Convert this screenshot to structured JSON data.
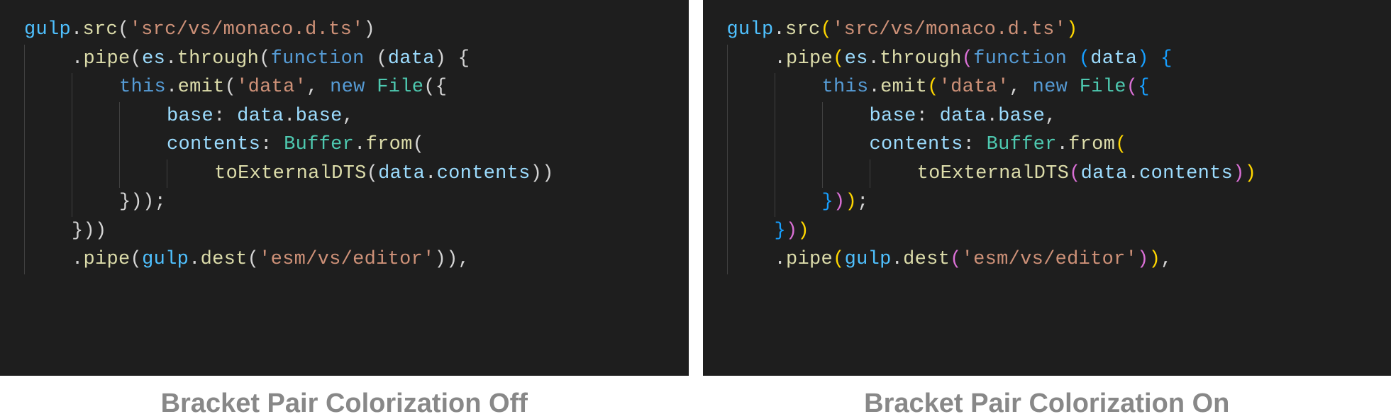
{
  "captions": {
    "left": "Bracket Pair Colorization Off",
    "right": "Bracket Pair Colorization On"
  },
  "palette": {
    "background": "#1e1e1e",
    "default_punc": "#d4d4d4",
    "bracket_levels": [
      "#ffd700",
      "#da70d6",
      "#179fff"
    ],
    "string": "#ce9178",
    "keyword": "#569cd6",
    "function": "#dcdcaa",
    "variable": "#9cdcfe",
    "object": "#4fc1ff",
    "type": "#4ec9b0"
  },
  "code": {
    "tokens": {
      "gulp": "gulp",
      "dot": ".",
      "src": "src",
      "open_paren": "(",
      "close_paren": ")",
      "open_brace": "{",
      "close_brace": "}",
      "str_monaco": "'src/vs/monaco.d.ts'",
      "pipe": "pipe",
      "es": "es",
      "through": "through",
      "function_kw": "function",
      "space": " ",
      "data": "data",
      "this_kw": "this",
      "emit": "emit",
      "str_data": "'data'",
      "comma": ",",
      "new_kw": "new",
      "File": "File",
      "base_key": "base",
      "colon": ":",
      "base_prop": "base",
      "contents_key": "contents",
      "Buffer": "Buffer",
      "from": "from",
      "toExternalDTS": "toExternalDTS",
      "contents_prop": "contents",
      "semi": ";",
      "dest": "dest",
      "str_editor": "'esm/vs/editor'"
    },
    "lines_spec": [
      {
        "indent": 0,
        "guides": 0
      },
      {
        "indent": 1,
        "guides": 1
      },
      {
        "indent": 2,
        "guides": 2
      },
      {
        "indent": 3,
        "guides": 3
      },
      {
        "indent": 3,
        "guides": 3
      },
      {
        "indent": 4,
        "guides": 4
      },
      {
        "indent": 2,
        "guides": 2
      },
      {
        "indent": 1,
        "guides": 1
      },
      {
        "indent": 1,
        "guides": 1
      }
    ]
  }
}
